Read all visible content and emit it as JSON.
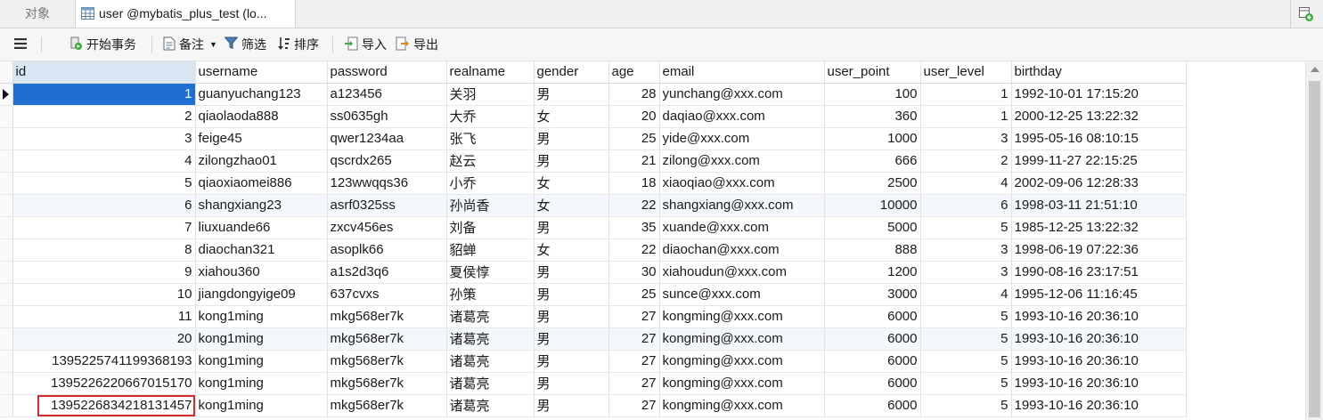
{
  "tabs": {
    "objects_label": "对象",
    "active_label": "user @mybatis_plus_test (lo..."
  },
  "toolbar": {
    "begin_transaction": "开始事务",
    "note": "备注",
    "filter": "筛选",
    "sort": "排序",
    "import": "导入",
    "export": "导出"
  },
  "table": {
    "columns": [
      "id",
      "username",
      "password",
      "realname",
      "gender",
      "age",
      "email",
      "user_point",
      "user_level",
      "birthday"
    ],
    "rows": [
      [
        "1",
        "guanyuchang123",
        "a123456",
        "关羽",
        "男",
        "28",
        "yunchang@xxx.com",
        "100",
        "1",
        "1992-10-01 17:15:20"
      ],
      [
        "2",
        "qiaolaoda888",
        "ss0635gh",
        "大乔",
        "女",
        "20",
        "daqiao@xxx.com",
        "360",
        "1",
        "2000-12-25 13:22:32"
      ],
      [
        "3",
        "feige45",
        "qwer1234aa",
        "张飞",
        "男",
        "25",
        "yide@xxx.com",
        "1000",
        "3",
        "1995-05-16 08:10:15"
      ],
      [
        "4",
        "zilongzhao01",
        "qscrdx265",
        "赵云",
        "男",
        "21",
        "zilong@xxx.com",
        "666",
        "2",
        "1999-11-27 22:15:25"
      ],
      [
        "5",
        "qiaoxiaomei886",
        "123wwqqs36",
        "小乔",
        "女",
        "18",
        "xiaoqiao@xxx.com",
        "2500",
        "4",
        "2002-09-06 12:28:33"
      ],
      [
        "6",
        "shangxiang23",
        "asrf0325ss",
        "孙尚香",
        "女",
        "22",
        "shangxiang@xxx.com",
        "10000",
        "6",
        "1998-03-11 21:51:10"
      ],
      [
        "7",
        "liuxuande66",
        "zxcv456es",
        "刘备",
        "男",
        "35",
        "xuande@xxx.com",
        "5000",
        "5",
        "1985-12-25 13:22:32"
      ],
      [
        "8",
        "diaochan321",
        "asoplk66",
        "貂蝉",
        "女",
        "22",
        "diaochan@xxx.com",
        "888",
        "3",
        "1998-06-19 07:22:36"
      ],
      [
        "9",
        "xiahou360",
        "a1s2d3q6",
        "夏侯惇",
        "男",
        "30",
        "xiahoudun@xxx.com",
        "1200",
        "3",
        "1990-08-16 23:17:51"
      ],
      [
        "10",
        "jiangdongyige09",
        "637cvxs",
        "孙策",
        "男",
        "25",
        "sunce@xxx.com",
        "3000",
        "4",
        "1995-12-06 11:16:45"
      ],
      [
        "11",
        "kong1ming",
        "mkg568er7k",
        "诸葛亮",
        "男",
        "27",
        "kongming@xxx.com",
        "6000",
        "5",
        "1993-10-16 20:36:10"
      ],
      [
        "20",
        "kong1ming",
        "mkg568er7k",
        "诸葛亮",
        "男",
        "27",
        "kongming@xxx.com",
        "6000",
        "5",
        "1993-10-16 20:36:10"
      ],
      [
        "1395225741199368193",
        "kong1ming",
        "mkg568er7k",
        "诸葛亮",
        "男",
        "27",
        "kongming@xxx.com",
        "6000",
        "5",
        "1993-10-16 20:36:10"
      ],
      [
        "1395226220667015170",
        "kong1ming",
        "mkg568er7k",
        "诸葛亮",
        "男",
        "27",
        "kongming@xxx.com",
        "6000",
        "5",
        "1993-10-16 20:36:10"
      ],
      [
        "1395226834218131457",
        "kong1ming",
        "mkg568er7k",
        "诸葛亮",
        "男",
        "27",
        "kongming@xxx.com",
        "6000",
        "5",
        "1993-10-16 20:36:10"
      ]
    ]
  },
  "colors": {
    "selected_cell": "#1f6fd0",
    "highlight_box": "#d72a2a",
    "header_active": "#d8e6f3"
  }
}
